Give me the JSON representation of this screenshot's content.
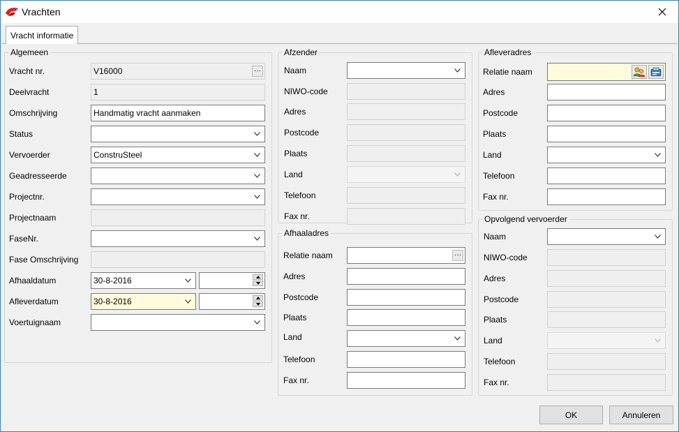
{
  "window": {
    "title": "Vrachten"
  },
  "tabs": [
    {
      "label": "Vracht informatie"
    }
  ],
  "algemeen": {
    "legend": "Algemeen",
    "vracht_nr": {
      "label": "Vracht nr.",
      "value": "V16000"
    },
    "deelvracht": {
      "label": "Deelvracht",
      "value": "1"
    },
    "omschrijving": {
      "label": "Omschrijving",
      "value": "Handmatig vracht aanmaken"
    },
    "status": {
      "label": "Status",
      "value": ""
    },
    "vervoerder": {
      "label": "Vervoerder",
      "value": "ConstruSteel"
    },
    "geadresseerde": {
      "label": "Geadresseerde",
      "value": ""
    },
    "projectnr": {
      "label": "Projectnr.",
      "value": ""
    },
    "projectnaam": {
      "label": "Projectnaam",
      "value": ""
    },
    "fasenr": {
      "label": "FaseNr.",
      "value": ""
    },
    "fase_omschrijving": {
      "label": "Fase Omschrijving",
      "value": ""
    },
    "afhaaldatum": {
      "label": "Afhaaldatum",
      "value": "30-8-2016",
      "time": ""
    },
    "afleverdatum": {
      "label": "Afleverdatum",
      "value": "30-8-2016",
      "time": ""
    },
    "voertuignaam": {
      "label": "Voertuignaam",
      "value": ""
    }
  },
  "afzender": {
    "legend": "Afzender",
    "naam": {
      "label": "Naam",
      "value": ""
    },
    "niwo": {
      "label": "NIWO-code",
      "value": ""
    },
    "adres": {
      "label": "Adres",
      "value": ""
    },
    "postcode": {
      "label": "Postcode",
      "value": ""
    },
    "plaats": {
      "label": "Plaats",
      "value": ""
    },
    "land": {
      "label": "Land",
      "value": ""
    },
    "telefoon": {
      "label": "Telefoon",
      "value": ""
    },
    "fax": {
      "label": "Fax nr.",
      "value": ""
    }
  },
  "afhaaladres": {
    "legend": "Afhaaladres",
    "relatie": {
      "label": "Relatie naam",
      "value": ""
    },
    "adres": {
      "label": "Adres",
      "value": ""
    },
    "postcode": {
      "label": "Postcode",
      "value": ""
    },
    "plaats": {
      "label": "Plaats",
      "value": ""
    },
    "land": {
      "label": "Land",
      "value": ""
    },
    "telefoon": {
      "label": "Telefoon",
      "value": ""
    },
    "fax": {
      "label": "Fax nr.",
      "value": ""
    }
  },
  "afleveradres": {
    "legend": "Afleveradres",
    "relatie": {
      "label": "Relatie naam",
      "value": ""
    },
    "adres": {
      "label": "Adres",
      "value": ""
    },
    "postcode": {
      "label": "Postcode",
      "value": ""
    },
    "plaats": {
      "label": "Plaats",
      "value": ""
    },
    "land": {
      "label": "Land",
      "value": ""
    },
    "telefoon": {
      "label": "Telefoon",
      "value": ""
    },
    "fax": {
      "label": "Fax nr.",
      "value": ""
    }
  },
  "opvolgend": {
    "legend": "Opvolgend vervoerder",
    "naam": {
      "label": "Naam",
      "value": ""
    },
    "niwo": {
      "label": "NIWO-code",
      "value": ""
    },
    "adres": {
      "label": "Adres",
      "value": ""
    },
    "postcode": {
      "label": "Postcode",
      "value": ""
    },
    "plaats": {
      "label": "Plaats",
      "value": ""
    },
    "land": {
      "label": "Land",
      "value": ""
    },
    "telefoon": {
      "label": "Telefoon",
      "value": ""
    },
    "fax": {
      "label": "Fax nr.",
      "value": ""
    }
  },
  "buttons": {
    "ok": "OK",
    "cancel": "Annuleren"
  },
  "colors": {
    "highlight_field": "#fffbdc",
    "accent_border": "#3c7fb1"
  },
  "icons": {
    "app": "app-logo-icon",
    "close": "close-icon",
    "dropdown": "chevron-down-icon",
    "browse": "ellipsis-icon",
    "relations": "contacts-icon",
    "addressbook": "address-book-icon"
  }
}
